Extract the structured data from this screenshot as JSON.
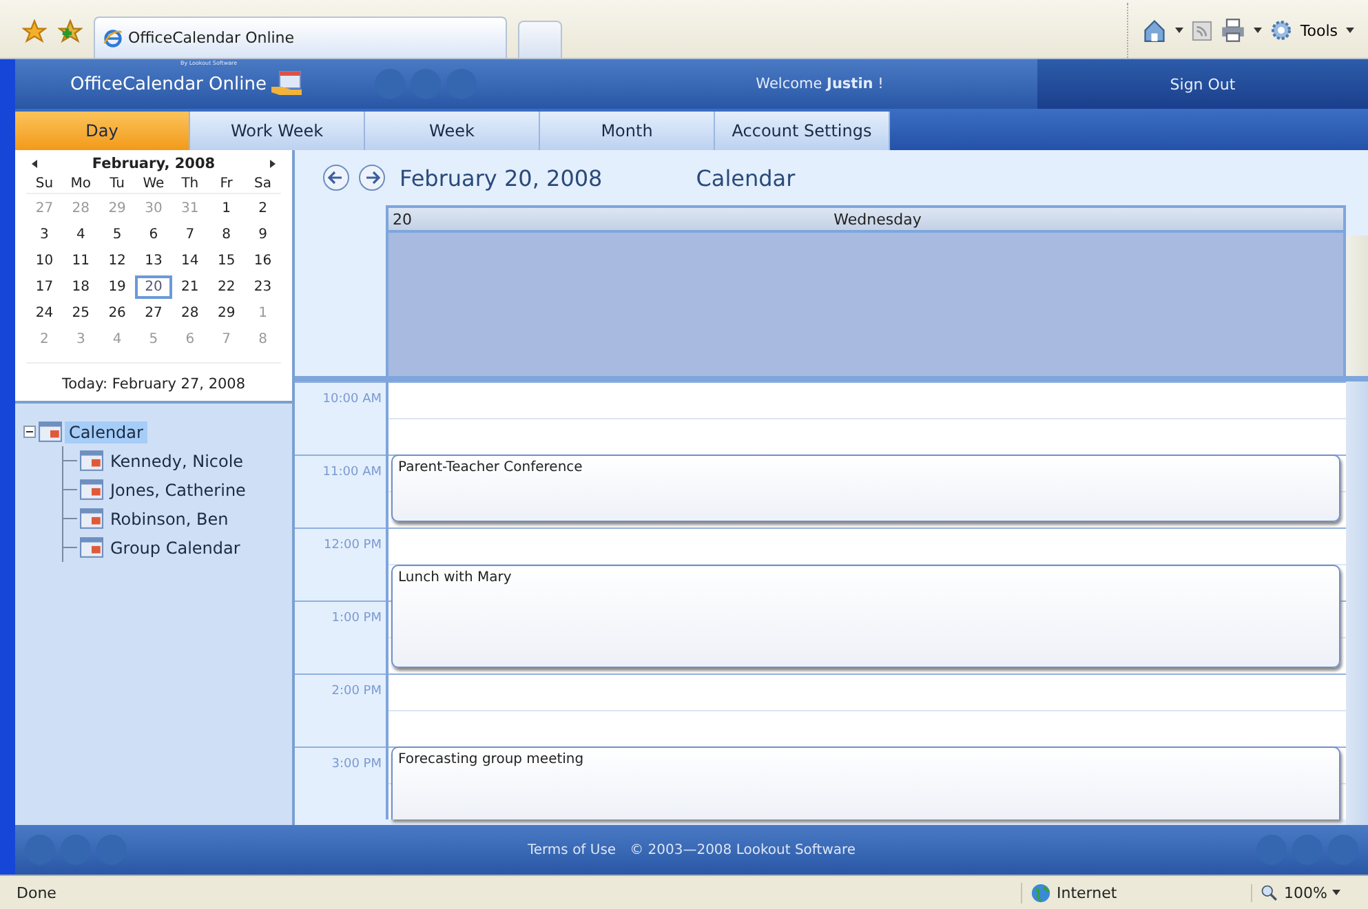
{
  "browser": {
    "tab_title": "OfficeCalendar Online",
    "tools_label": "Tools"
  },
  "header": {
    "tagline": "By Lookout Software",
    "logo_text": "OfficeCalendar Online",
    "welcome": "Welcome **Justin** !",
    "sign_out": "Sign Out"
  },
  "nav_tabs": [
    {
      "label": "Day",
      "selected": true
    },
    {
      "label": "Work Week",
      "selected": false
    },
    {
      "label": "Week",
      "selected": false
    },
    {
      "label": "Month",
      "selected": false
    },
    {
      "label": "Account Settings",
      "selected": false
    }
  ],
  "mini_calendar": {
    "title": "February, 2008",
    "weekdays": [
      "Su",
      "Mo",
      "Tu",
      "We",
      "Th",
      "Fr",
      "Sa"
    ],
    "weeks": [
      [
        {
          "day": "27",
          "other_month": true,
          "selected": false
        },
        {
          "day": "28",
          "other_month": true,
          "selected": false
        },
        {
          "day": "29",
          "other_month": true,
          "selected": false
        },
        {
          "day": "30",
          "other_month": true,
          "selected": false
        },
        {
          "day": "31",
          "other_month": true,
          "selected": false
        },
        {
          "day": "1",
          "other_month": false,
          "selected": false
        },
        {
          "day": "2",
          "other_month": false,
          "selected": false
        }
      ],
      [
        {
          "day": "3",
          "other_month": false,
          "selected": false
        },
        {
          "day": "4",
          "other_month": false,
          "selected": false
        },
        {
          "day": "5",
          "other_month": false,
          "selected": false
        },
        {
          "day": "6",
          "other_month": false,
          "selected": false
        },
        {
          "day": "7",
          "other_month": false,
          "selected": false
        },
        {
          "day": "8",
          "other_month": false,
          "selected": false
        },
        {
          "day": "9",
          "other_month": false,
          "selected": false
        }
      ],
      [
        {
          "day": "10",
          "other_month": false,
          "selected": false
        },
        {
          "day": "11",
          "other_month": false,
          "selected": false
        },
        {
          "day": "12",
          "other_month": false,
          "selected": false
        },
        {
          "day": "13",
          "other_month": false,
          "selected": false
        },
        {
          "day": "14",
          "other_month": false,
          "selected": false
        },
        {
          "day": "15",
          "other_month": false,
          "selected": false
        },
        {
          "day": "16",
          "other_month": false,
          "selected": false
        }
      ],
      [
        {
          "day": "17",
          "other_month": false,
          "selected": false
        },
        {
          "day": "18",
          "other_month": false,
          "selected": false
        },
        {
          "day": "19",
          "other_month": false,
          "selected": false
        },
        {
          "day": "20",
          "other_month": false,
          "selected": true
        },
        {
          "day": "21",
          "other_month": false,
          "selected": false
        },
        {
          "day": "22",
          "other_month": false,
          "selected": false
        },
        {
          "day": "23",
          "other_month": false,
          "selected": false
        }
      ],
      [
        {
          "day": "24",
          "other_month": false,
          "selected": false
        },
        {
          "day": "25",
          "other_month": false,
          "selected": false
        },
        {
          "day": "26",
          "other_month": false,
          "selected": false
        },
        {
          "day": "27",
          "other_month": false,
          "selected": false
        },
        {
          "day": "28",
          "other_month": false,
          "selected": false
        },
        {
          "day": "29",
          "other_month": false,
          "selected": false
        },
        {
          "day": "1",
          "other_month": true,
          "selected": false
        }
      ],
      [
        {
          "day": "2",
          "other_month": true,
          "selected": false
        },
        {
          "day": "3",
          "other_month": true,
          "selected": false
        },
        {
          "day": "4",
          "other_month": true,
          "selected": false
        },
        {
          "day": "5",
          "other_month": true,
          "selected": false
        },
        {
          "day": "6",
          "other_month": true,
          "selected": false
        },
        {
          "day": "7",
          "other_month": true,
          "selected": false
        },
        {
          "day": "8",
          "other_month": true,
          "selected": false
        }
      ]
    ],
    "today": "Today: February 27, 2008"
  },
  "calendar_tree": {
    "label": "Calendar",
    "selected": true,
    "expanded": true,
    "children": [
      {
        "label": "Kennedy, Nicole",
        "selected": false
      },
      {
        "label": "Jones, Catherine",
        "selected": false
      },
      {
        "label": "Robinson, Ben",
        "selected": false
      },
      {
        "label": "Group Calendar",
        "selected": false
      }
    ]
  },
  "day_view": {
    "date_title": "February 20, 2008",
    "view_name": "Calendar",
    "day_number": "20",
    "weekday": "Wednesday",
    "rows": [
      {
        "time": "10:00 AM"
      },
      {},
      {
        "time": "11:00 AM",
        "event": "Parent-Teacher Conference"
      },
      {
        "event_continues": true
      },
      {
        "time": "12:00 PM"
      },
      {
        "event": "Lunch with Mary"
      },
      {
        "time": "1:00 PM",
        "event_continues": true
      },
      {
        "event_continues": true
      },
      {
        "time": "2:00 PM"
      },
      {},
      {
        "time": "3:00 PM",
        "event": "Forecasting group meeting"
      },
      {
        "event_continues": true
      }
    ]
  },
  "footer": {
    "terms_link": "Terms of Use",
    "copyright": "© 2003—2008 Lookout Software"
  },
  "status_bar": {
    "status": "Done",
    "zone": "Internet",
    "zoom": "100%"
  }
}
